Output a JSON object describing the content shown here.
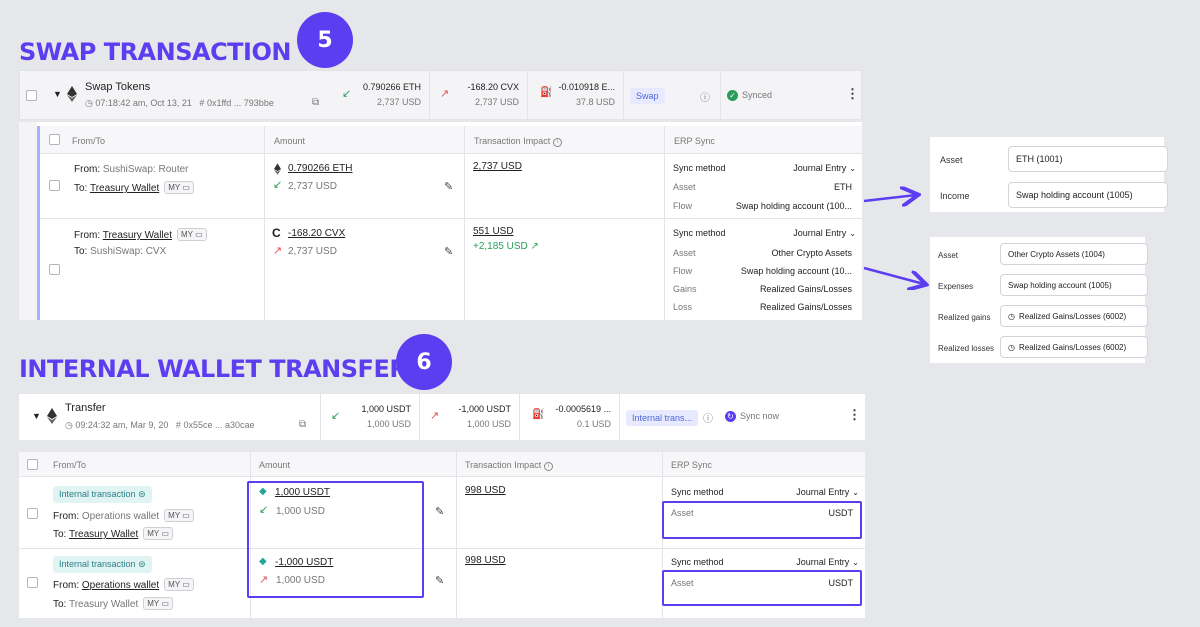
{
  "swap": {
    "title": "SWAP TRANSACTION",
    "step": "5",
    "header": {
      "name": "Swap Tokens",
      "time": "07:18:42 am, Oct 13, 21",
      "hash": "0x1ffd ... 793bbe",
      "in_amount": "0.790266 ETH",
      "in_usd": "2,737 USD",
      "out_amount": "-168.20 CVX",
      "out_usd": "2,737 USD",
      "fee_amount": "-0.010918 E...",
      "fee_usd": "37.8 USD",
      "type_badge": "Swap",
      "status": "Synced"
    },
    "columns": {
      "from_to": "From/To",
      "amount": "Amount",
      "impact": "Transaction Impact",
      "erp": "ERP Sync"
    },
    "rows": [
      {
        "from_label": "From:",
        "from": "SushiSwap: Router",
        "to_label": "To:",
        "to": "Treasury Wallet",
        "to_tag": "MY",
        "amount": "0.790266 ETH",
        "amount_usd": "2,737 USD",
        "impact": "2,737 USD",
        "sync_method_label": "Sync method",
        "sync_method": "Journal Entry",
        "asset_label": "Asset",
        "asset": "ETH",
        "flow_label": "Flow",
        "flow": "Swap holding account (100..."
      },
      {
        "from_label": "From:",
        "from": "Treasury Wallet",
        "from_tag": "MY",
        "to_label": "To:",
        "to": "SushiSwap: CVX",
        "amount": "-168.20 CVX",
        "amount_usd": "2,737 USD",
        "impact": "551 USD",
        "impact_gain": "+2,185 USD",
        "sync_method_label": "Sync method",
        "sync_method": "Journal Entry",
        "asset_label": "Asset",
        "asset": "Other Crypto Assets",
        "flow_label": "Flow",
        "flow": "Swap holding account (10...",
        "gains_label": "Gains",
        "gains": "Realized Gains/Losses",
        "loss_label": "Loss",
        "loss": "Realized Gains/Losses"
      }
    ],
    "callout1": {
      "asset_label": "Asset",
      "asset": "ETH (1001)",
      "income_label": "Income",
      "income": "Swap holding account (1005)"
    },
    "callout2": {
      "asset_label": "Asset",
      "asset": "Other Crypto Assets (1004)",
      "expenses_label": "Expenses",
      "expenses": "Swap holding account (1005)",
      "gains_label": "Realized gains",
      "gains": "Realized Gains/Losses (6002)",
      "losses_label": "Realized losses",
      "losses": "Realized Gains/Losses (6002)"
    }
  },
  "transfer": {
    "title": "INTERNAL WALLET TRANSFER",
    "step": "6",
    "header": {
      "name": "Transfer",
      "time": "09:24:32 am, Mar 9, 20",
      "hash": "0x55ce ... a30cae",
      "in_amount": "1,000 USDT",
      "in_usd": "1,000 USD",
      "out_amount": "-1,000 USDT",
      "out_usd": "1,000 USD",
      "fee_amount": "-0.0005619 ...",
      "fee_usd": "0.1 USD",
      "type_badge": "Internal trans...",
      "status": "Sync now"
    },
    "columns": {
      "from_to": "From/To",
      "amount": "Amount",
      "impact": "Transaction Impact",
      "erp": "ERP Sync"
    },
    "rows": [
      {
        "badge": "Internal transaction",
        "from_label": "From:",
        "from": "Operations wallet",
        "from_tag": "MY",
        "to_label": "To:",
        "to": "Treasury Wallet",
        "to_tag": "MY",
        "amount": "1,000 USDT",
        "amount_usd": "1,000 USD",
        "impact": "998 USD",
        "sync_method_label": "Sync method",
        "sync_method": "Journal Entry",
        "asset_label": "Asset",
        "asset": "USDT"
      },
      {
        "badge": "Internal transaction",
        "from_label": "From:",
        "from": "Operations wallet",
        "from_tag": "MY",
        "to_label": "To:",
        "to": "Treasury Wallet",
        "to_tag": "MY",
        "amount": "-1,000 USDT",
        "amount_usd": "1,000 USD",
        "impact": "998 USD",
        "sync_method_label": "Sync method",
        "sync_method": "Journal Entry",
        "asset_label": "Asset",
        "asset": "USDT"
      }
    ]
  },
  "colors": {
    "accent": "#5b3ef0",
    "green": "#2a9d5a",
    "red": "#e05252"
  }
}
